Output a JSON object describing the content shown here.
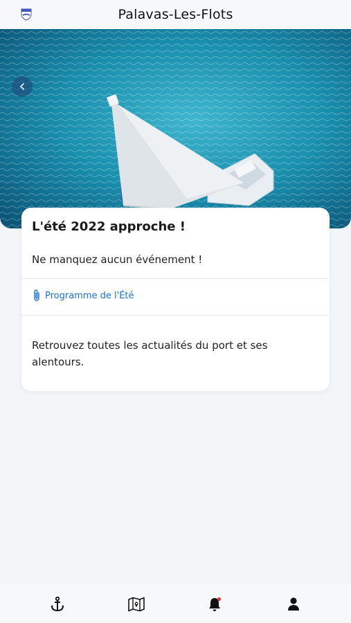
{
  "header": {
    "title": "Palavas-Les-Flots",
    "logo_icon": "town-crest-icon"
  },
  "hero": {
    "description_icon": "back-arrow-icon"
  },
  "article": {
    "title": "L'été 2022 approche !",
    "subtitle": "Ne manquez aucun événement !",
    "attachment": {
      "icon": "paperclip-icon",
      "label": "Programme de l'Été"
    },
    "body": "Retrouvez toutes les actualités du port et ses alentours."
  },
  "tabbar": {
    "items": [
      {
        "icon": "anchor-icon"
      },
      {
        "icon": "map-icon"
      },
      {
        "icon": "bell-icon",
        "badge_color": "#e53935"
      },
      {
        "icon": "user-icon"
      }
    ]
  },
  "colors": {
    "accent": "#1a73d9",
    "background": "#f3f6f9",
    "card": "#ffffff"
  }
}
